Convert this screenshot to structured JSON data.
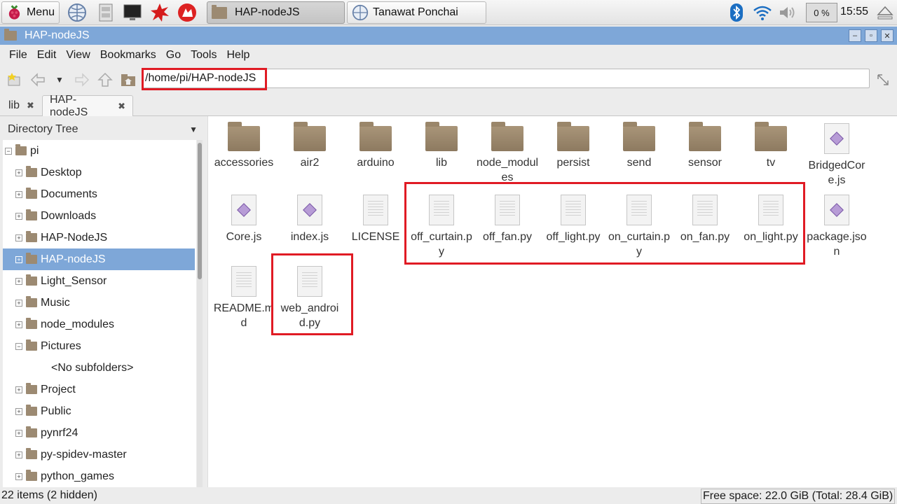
{
  "taskbar": {
    "menu_label": "Menu",
    "window_buttons": [
      "HAP-nodeJS",
      "Tanawat Ponchai"
    ],
    "cpu": "0 %",
    "clock": "15:55"
  },
  "window": {
    "title": "HAP-nodeJS"
  },
  "menubar": {
    "items": [
      "File",
      "Edit",
      "View",
      "Bookmarks",
      "Go",
      "Tools",
      "Help"
    ]
  },
  "toolbar": {
    "path": "/home/pi/HAP-nodeJS"
  },
  "tabs": [
    {
      "label": "lib"
    },
    {
      "label": "HAP-nodeJS"
    }
  ],
  "sidebar": {
    "header": "Directory Tree",
    "root": "pi",
    "items": [
      {
        "label": "Desktop"
      },
      {
        "label": "Documents"
      },
      {
        "label": "Downloads"
      },
      {
        "label": "HAP-NodeJS"
      },
      {
        "label": "HAP-nodeJS"
      },
      {
        "label": "Light_Sensor"
      },
      {
        "label": "Music"
      },
      {
        "label": "node_modules"
      },
      {
        "label": "Pictures"
      },
      {
        "label": "<No subfolders>"
      },
      {
        "label": "Project"
      },
      {
        "label": "Public"
      },
      {
        "label": "pynrf24"
      },
      {
        "label": "py-spidev-master"
      },
      {
        "label": "python_games"
      }
    ]
  },
  "files": {
    "row1": [
      {
        "name": "accessories",
        "type": "folder"
      },
      {
        "name": "air2",
        "type": "folder"
      },
      {
        "name": "arduino",
        "type": "folder"
      },
      {
        "name": "lib",
        "type": "folder"
      },
      {
        "name": "node_modules",
        "type": "folder"
      },
      {
        "name": "persist",
        "type": "folder"
      },
      {
        "name": "send",
        "type": "folder"
      },
      {
        "name": "sensor",
        "type": "folder"
      },
      {
        "name": "tv",
        "type": "folder"
      },
      {
        "name": "BridgedCore.js",
        "type": "js"
      }
    ],
    "row2": [
      {
        "name": "Core.js",
        "type": "js"
      },
      {
        "name": "index.js",
        "type": "js"
      },
      {
        "name": "LICENSE",
        "type": "text"
      },
      {
        "name": "off_curtain.py",
        "type": "text"
      },
      {
        "name": "off_fan.py",
        "type": "text"
      },
      {
        "name": "off_light.py",
        "type": "text"
      },
      {
        "name": "on_curtain.py",
        "type": "text"
      },
      {
        "name": "on_fan.py",
        "type": "text"
      },
      {
        "name": "on_light.py",
        "type": "text"
      },
      {
        "name": "package.json",
        "type": "js"
      }
    ],
    "row3": [
      {
        "name": "README.md",
        "type": "text"
      },
      {
        "name": "web_android.py",
        "type": "text"
      }
    ]
  },
  "status": {
    "items": "22 items (2 hidden)",
    "free_space": "Free space: 22.0 GiB (Total: 28.4 GiB)"
  },
  "colors": {
    "selection": "#7ea7d8",
    "highlight_box": "#e01b24"
  }
}
